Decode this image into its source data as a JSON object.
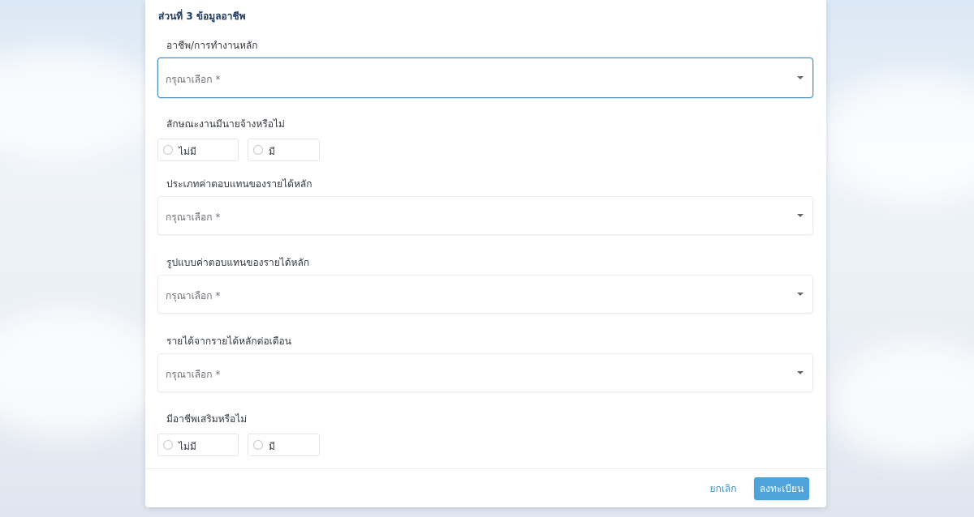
{
  "section": {
    "title": "ส่วนที่ 3 ข้อมูลอาชีพ"
  },
  "fields": {
    "occupation": {
      "label": "อาชีพ/การทำงานหลัก",
      "placeholder": "กรุณาเลือก *"
    },
    "has_employer": {
      "label": "ลักษณะงานมีนายจ้างหรือไม่",
      "options": [
        "ไม่มี",
        "มี"
      ]
    },
    "income_type": {
      "label": "ประเภทค่าตอบแทนของรายได้หลัก",
      "placeholder": "กรุณาเลือก *"
    },
    "income_format": {
      "label": "รูปแบบค่าตอบแทนของรายได้หลัก",
      "placeholder": "กรุณาเลือก *"
    },
    "monthly_income": {
      "label": "รายได้จากรายได้หลักต่อเดือน",
      "placeholder": "กรุณาเลือก *"
    },
    "has_side_job": {
      "label": "มีอาชีพเสริมหรือไม่",
      "options": [
        "ไม่มี",
        "มี"
      ]
    }
  },
  "footer": {
    "cancel_label": "ยกเลิก",
    "submit_label": "ลงทะเบียน"
  },
  "colors": {
    "accent": "#4ea3dc",
    "focus_border": "#4a8fb8",
    "title": "#1f3a5f"
  }
}
